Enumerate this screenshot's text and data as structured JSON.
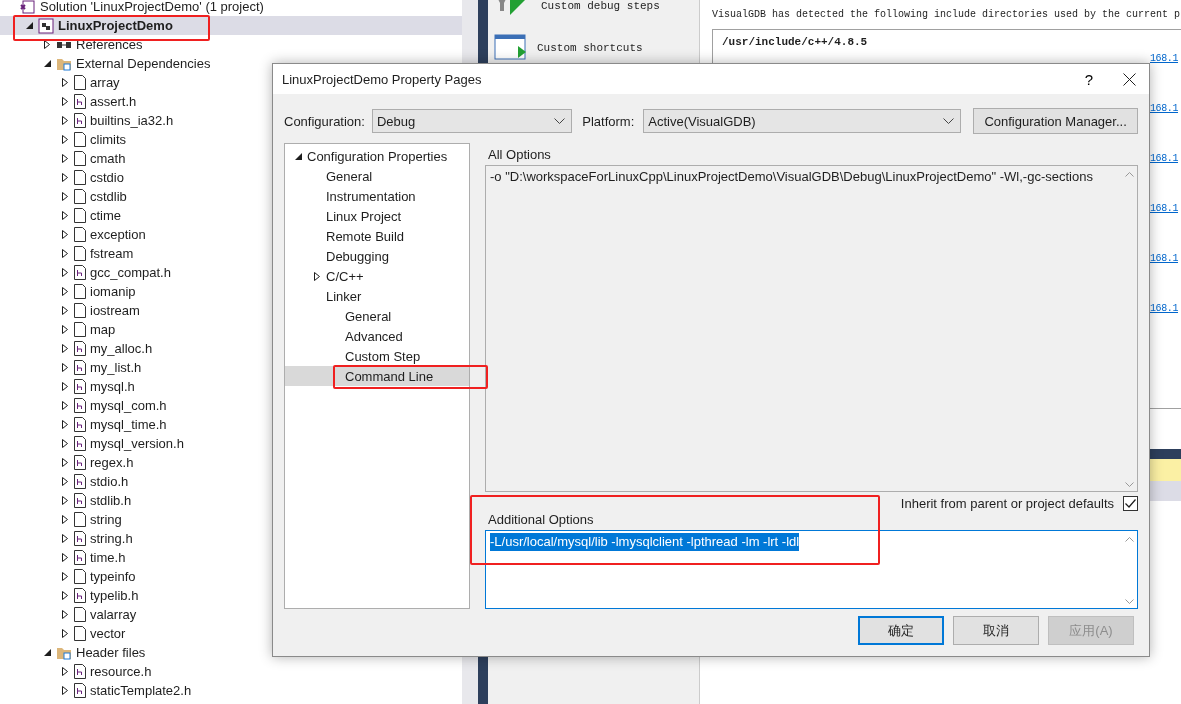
{
  "solution_explorer": {
    "items": [
      {
        "label": "Solution 'LinuxProjectDemo' (1 project)",
        "kind": "solution",
        "selected": false,
        "children": [
          {
            "label": "LinuxProjectDemo",
            "kind": "project",
            "selected": true,
            "expanded": true,
            "annotated": true,
            "children": [
              {
                "label": "References",
                "kind": "references",
                "selected": false,
                "expanded": false
              },
              {
                "label": "External Dependencies",
                "kind": "folder",
                "selected": false,
                "expanded": true,
                "children": [
                  {
                    "label": "array",
                    "kind": "file",
                    "selected": false,
                    "expanded": false
                  },
                  {
                    "label": "assert.h",
                    "kind": "header",
                    "selected": false,
                    "expanded": false
                  },
                  {
                    "label": "builtins_ia32.h",
                    "kind": "header",
                    "selected": false,
                    "expanded": false
                  },
                  {
                    "label": "climits",
                    "kind": "file",
                    "selected": false,
                    "expanded": false
                  },
                  {
                    "label": "cmath",
                    "kind": "file",
                    "selected": false,
                    "expanded": false
                  },
                  {
                    "label": "cstdio",
                    "kind": "file",
                    "selected": false,
                    "expanded": false
                  },
                  {
                    "label": "cstdlib",
                    "kind": "file",
                    "selected": false,
                    "expanded": false
                  },
                  {
                    "label": "ctime",
                    "kind": "file",
                    "selected": false,
                    "expanded": false
                  },
                  {
                    "label": "exception",
                    "kind": "file",
                    "selected": false,
                    "expanded": false
                  },
                  {
                    "label": "fstream",
                    "kind": "file",
                    "selected": false,
                    "expanded": false
                  },
                  {
                    "label": "gcc_compat.h",
                    "kind": "header",
                    "selected": false,
                    "expanded": false
                  },
                  {
                    "label": "iomanip",
                    "kind": "file",
                    "selected": false,
                    "expanded": false
                  },
                  {
                    "label": "iostream",
                    "kind": "file",
                    "selected": false,
                    "expanded": false
                  },
                  {
                    "label": "map",
                    "kind": "file",
                    "selected": false,
                    "expanded": false
                  },
                  {
                    "label": "my_alloc.h",
                    "kind": "header",
                    "selected": false,
                    "expanded": false
                  },
                  {
                    "label": "my_list.h",
                    "kind": "header",
                    "selected": false,
                    "expanded": false
                  },
                  {
                    "label": "mysql.h",
                    "kind": "header",
                    "selected": false,
                    "expanded": false
                  },
                  {
                    "label": "mysql_com.h",
                    "kind": "header",
                    "selected": false,
                    "expanded": false
                  },
                  {
                    "label": "mysql_time.h",
                    "kind": "header",
                    "selected": false,
                    "expanded": false
                  },
                  {
                    "label": "mysql_version.h",
                    "kind": "header",
                    "selected": false,
                    "expanded": false
                  },
                  {
                    "label": "regex.h",
                    "kind": "header",
                    "selected": false,
                    "expanded": false
                  },
                  {
                    "label": "stdio.h",
                    "kind": "header",
                    "selected": false,
                    "expanded": false
                  },
                  {
                    "label": "stdlib.h",
                    "kind": "header",
                    "selected": false,
                    "expanded": false
                  },
                  {
                    "label": "string",
                    "kind": "file",
                    "selected": false,
                    "expanded": false
                  },
                  {
                    "label": "string.h",
                    "kind": "header",
                    "selected": false,
                    "expanded": false
                  },
                  {
                    "label": "time.h",
                    "kind": "header",
                    "selected": false,
                    "expanded": false
                  },
                  {
                    "label": "typeinfo",
                    "kind": "file",
                    "selected": false,
                    "expanded": false
                  },
                  {
                    "label": "typelib.h",
                    "kind": "header",
                    "selected": false,
                    "expanded": false
                  },
                  {
                    "label": "valarray",
                    "kind": "file",
                    "selected": false,
                    "expanded": false
                  },
                  {
                    "label": "vector",
                    "kind": "file",
                    "selected": false,
                    "expanded": false
                  }
                ]
              },
              {
                "label": "Header files",
                "kind": "folder",
                "selected": false,
                "expanded": true,
                "children": [
                  {
                    "label": "resource.h",
                    "kind": "header",
                    "selected": false,
                    "expanded": false
                  },
                  {
                    "label": "staticTemplate2.h",
                    "kind": "header",
                    "selected": false,
                    "expanded": false
                  }
                ]
              }
            ]
          }
        ]
      }
    ]
  },
  "tools": [
    {
      "label": "Custom debug steps",
      "kind": "debug-steps"
    },
    {
      "label": "Custom shortcuts",
      "kind": "shortcuts"
    }
  ],
  "include_panel": {
    "intro": "VisualGDB has detected the following include directories used by the current p",
    "directory": "/usr/include/c++/4.8.5",
    "links": [
      "168.1",
      "168.1",
      "168.1",
      "168.1",
      "168.1",
      "168.1"
    ]
  },
  "dialog": {
    "title": "LinuxProjectDemo Property Pages",
    "help_button": "?",
    "configuration": {
      "label": "Configuration:",
      "value": "Debug"
    },
    "platform": {
      "label": "Platform:",
      "value": "Active(VisualGDB)"
    },
    "manager_button": "Configuration Manager...",
    "tree": [
      {
        "label": "Configuration Properties",
        "expanded": true,
        "selected": false,
        "children": [
          {
            "label": "General",
            "selected": false
          },
          {
            "label": "Instrumentation",
            "selected": false
          },
          {
            "label": "Linux Project",
            "selected": false
          },
          {
            "label": "Remote Build",
            "selected": false
          },
          {
            "label": "Debugging",
            "selected": false
          },
          {
            "label": "C/C++",
            "selected": false,
            "expanded": false
          },
          {
            "label": "Linker",
            "selected": false,
            "children": [
              {
                "label": "General",
                "selected": false
              },
              {
                "label": "Advanced",
                "selected": false
              },
              {
                "label": "Custom Step",
                "selected": false
              },
              {
                "label": "Command Line",
                "selected": true,
                "annotated": true
              }
            ]
          }
        ]
      }
    ],
    "all_options": {
      "label": "All Options",
      "value": "-o \"D:\\workspaceForLinuxCpp\\LinuxProjectDemo\\VisualGDB\\Debug\\LinuxProjectDemo\" -Wl,-gc-sections"
    },
    "additional_options": {
      "label": "Additional Options",
      "value": "-L/usr/local/mysql/lib -lmysqlclient -lpthread -lm -lrt -ldl",
      "text_selected": true,
      "annotated": true
    },
    "inherit": {
      "label": "Inherit from parent or project defaults",
      "checked": true
    },
    "buttons": [
      {
        "label": "确定",
        "kind": "default",
        "disabled": false
      },
      {
        "label": "取消",
        "kind": "normal",
        "disabled": false
      },
      {
        "label": "应用(A)",
        "kind": "normal",
        "disabled": true
      }
    ]
  }
}
